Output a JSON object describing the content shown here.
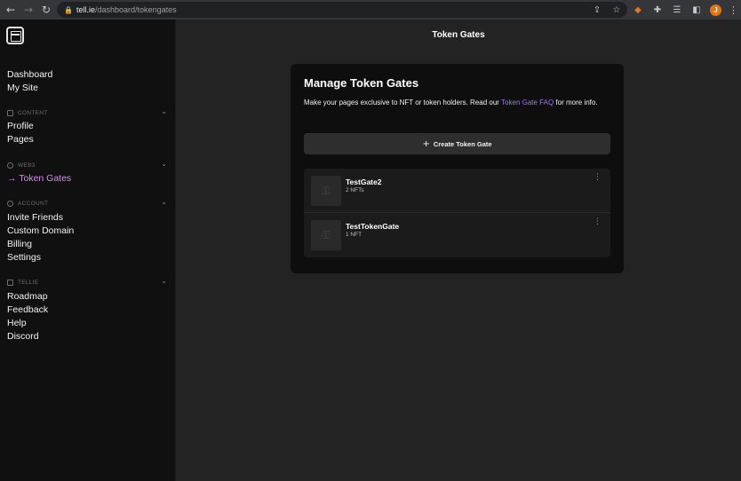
{
  "browser": {
    "url_host": "tell.ie",
    "url_path": "/dashboard/tokengates",
    "avatar_initial": "J"
  },
  "icons": {
    "back": "arrow-left-icon",
    "forward": "arrow-right-icon",
    "reload": "reload-icon",
    "lock": "lock-icon",
    "share": "share-icon",
    "bookmark": "star-icon",
    "metamask": "fox-extension-icon",
    "extensions": "puzzle-icon",
    "reading_list": "reading-list-icon",
    "side_panel": "side-panel-icon",
    "menu": "kebab-menu-icon"
  },
  "sidebar": {
    "top_links": [
      {
        "label": "Dashboard"
      },
      {
        "label": "My Site"
      }
    ],
    "sections": [
      {
        "title": "CONTENT",
        "items": [
          {
            "label": "Profile"
          },
          {
            "label": "Pages"
          }
        ]
      },
      {
        "title": "WEB3",
        "items": [
          {
            "label": "→ Token Gates",
            "active": true
          }
        ]
      },
      {
        "title": "ACCOUNT",
        "items": [
          {
            "label": "Invite Friends"
          },
          {
            "label": "Custom Domain"
          },
          {
            "label": "Billing"
          },
          {
            "label": "Settings"
          }
        ]
      },
      {
        "title": "TELLIE",
        "items": [
          {
            "label": "Roadmap"
          },
          {
            "label": "Feedback"
          },
          {
            "label": "Help"
          },
          {
            "label": "Discord"
          }
        ]
      }
    ]
  },
  "main": {
    "title": "Token Gates",
    "card": {
      "heading": "Manage Token Gates",
      "description_pre": "Make your pages exclusive to NFT or token holders. Read our ",
      "faq_link": "Token Gate FAQ",
      "description_post": " for more info.",
      "create_button": "Create Token Gate",
      "gates": [
        {
          "name": "TestGate2",
          "count": "2 NFTs"
        },
        {
          "name": "TestTokenGate",
          "count": "1 NFT"
        }
      ]
    }
  },
  "colors": {
    "accent_active": "#d88bf0",
    "link": "#9f7aea",
    "background": "#232323",
    "sidebar": "#101010"
  }
}
